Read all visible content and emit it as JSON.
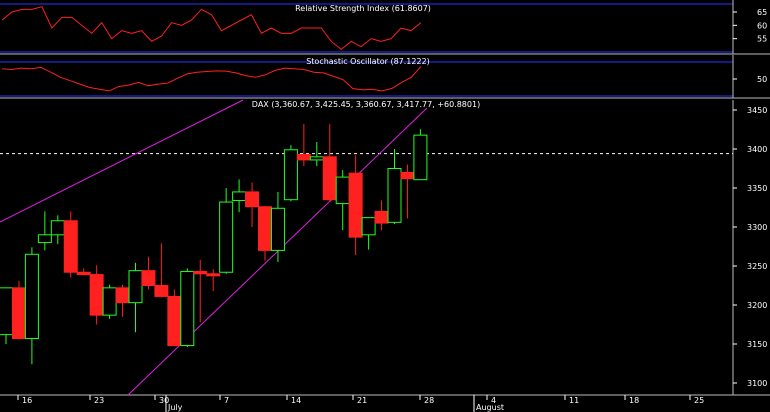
{
  "chart_data": [
    {
      "id": "rsi",
      "type": "line",
      "title": "Relative Strength Index (61.8607)",
      "yticks": [
        55,
        60,
        65
      ],
      "ylim": [
        50,
        68
      ],
      "series": [
        {
          "name": "RSI",
          "color": "#ff2020",
          "values": [
            62,
            65,
            66,
            66,
            67,
            59,
            63,
            63,
            60,
            57,
            61,
            55,
            58,
            57,
            58,
            54,
            56,
            61,
            60,
            62,
            66,
            64,
            58,
            60,
            62,
            64,
            57,
            59,
            57,
            57,
            59,
            59,
            59,
            54,
            51,
            54,
            52,
            55,
            54,
            55,
            59,
            58,
            61
          ]
        }
      ]
    },
    {
      "id": "stochastic",
      "type": "line",
      "title": "Stochastic Oscillator (87.1222)",
      "yticks": [
        50
      ],
      "ylim": [
        0,
        100
      ],
      "series": [
        {
          "name": "Stochastic",
          "color": "#ff2020",
          "values": [
            80,
            78,
            82,
            80,
            84,
            70,
            55,
            45,
            35,
            25,
            20,
            15,
            28,
            32,
            40,
            30,
            35,
            38,
            52,
            65,
            70,
            72,
            74,
            73,
            68,
            60,
            55,
            62,
            75,
            82,
            80,
            78,
            70,
            68,
            58,
            48,
            22,
            18,
            20,
            15,
            22,
            40,
            55,
            87
          ]
        }
      ]
    },
    {
      "id": "dax",
      "type": "candlestick",
      "title": "DAX (3,360.67, 3,425.45, 3,360.67, 3,417.77, +60.8801)",
      "yticks": [
        3100,
        3150,
        3200,
        3250,
        3300,
        3350,
        3400,
        3450
      ],
      "ylim": [
        3095,
        3467
      ],
      "xlabels": [
        "16",
        "23",
        "30",
        "7",
        "14",
        "21",
        "28",
        "4",
        "11",
        "18",
        "25"
      ],
      "months": [
        "July",
        "August"
      ],
      "reference_level": 3394,
      "candles": [
        {
          "o": 3162,
          "h": 3218,
          "l": 3150,
          "c": 3222
        },
        {
          "o": 3222,
          "h": 3231,
          "l": 3156,
          "c": 3157
        },
        {
          "o": 3157,
          "h": 3274,
          "l": 3124,
          "c": 3265
        },
        {
          "o": 3280,
          "h": 3320,
          "l": 3270,
          "c": 3290
        },
        {
          "o": 3290,
          "h": 3315,
          "l": 3278,
          "c": 3308
        },
        {
          "o": 3308,
          "h": 3320,
          "l": 3235,
          "c": 3242
        },
        {
          "o": 3242,
          "h": 3247,
          "l": 3238,
          "c": 3239
        },
        {
          "o": 3239,
          "h": 3251,
          "l": 3175,
          "c": 3187
        },
        {
          "o": 3187,
          "h": 3226,
          "l": 3182,
          "c": 3222
        },
        {
          "o": 3222,
          "h": 3226,
          "l": 3185,
          "c": 3203
        },
        {
          "o": 3203,
          "h": 3254,
          "l": 3165,
          "c": 3244
        },
        {
          "o": 3244,
          "h": 3262,
          "l": 3220,
          "c": 3225
        },
        {
          "o": 3225,
          "h": 3279,
          "l": 3210,
          "c": 3211
        },
        {
          "o": 3211,
          "h": 3220,
          "l": 3150,
          "c": 3148
        },
        {
          "o": 3148,
          "h": 3247,
          "l": 3146,
          "c": 3243
        },
        {
          "o": 3243,
          "h": 3258,
          "l": 3178,
          "c": 3240
        },
        {
          "o": 3240,
          "h": 3246,
          "l": 3218,
          "c": 3238
        },
        {
          "o": 3242,
          "h": 3350,
          "l": 3240,
          "c": 3332
        },
        {
          "o": 3334,
          "h": 3361,
          "l": 3319,
          "c": 3345
        },
        {
          "o": 3345,
          "h": 3357,
          "l": 3300,
          "c": 3326
        },
        {
          "o": 3326,
          "h": 3327,
          "l": 3257,
          "c": 3270
        },
        {
          "o": 3270,
          "h": 3345,
          "l": 3255,
          "c": 3324
        },
        {
          "o": 3335,
          "h": 3405,
          "l": 3333,
          "c": 3399
        },
        {
          "o": 3393,
          "h": 3432,
          "l": 3378,
          "c": 3386
        },
        {
          "o": 3386,
          "h": 3409,
          "l": 3378,
          "c": 3390
        },
        {
          "o": 3390,
          "h": 3432,
          "l": 3333,
          "c": 3335
        },
        {
          "o": 3330,
          "h": 3373,
          "l": 3296,
          "c": 3364
        },
        {
          "o": 3369,
          "h": 3392,
          "l": 3264,
          "c": 3287
        },
        {
          "o": 3290,
          "h": 3311,
          "l": 3271,
          "c": 3312
        },
        {
          "o": 3320,
          "h": 3334,
          "l": 3296,
          "c": 3305
        },
        {
          "o": 3306,
          "h": 3400,
          "l": 3304,
          "c": 3375
        },
        {
          "o": 3370,
          "h": 3380,
          "l": 3311,
          "c": 3362
        },
        {
          "o": 3360.67,
          "h": 3425.45,
          "l": 3360.67,
          "c": 3417.77
        }
      ]
    }
  ]
}
